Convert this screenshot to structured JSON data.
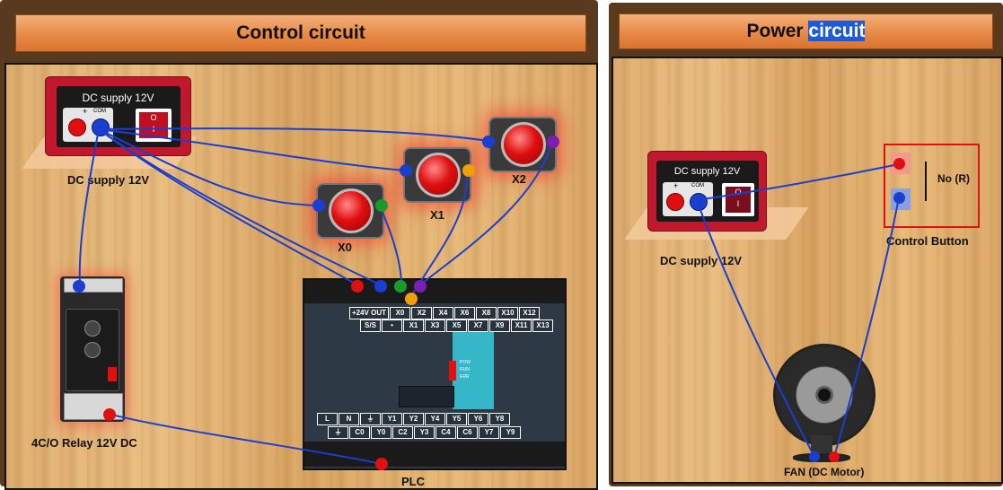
{
  "control": {
    "title": "Control circuit",
    "dc_supply_title": "DC supply 12V",
    "dc_supply_label": "DC supply 12V",
    "jack_plus": "+",
    "jack_com": "COM",
    "switch_o": "O",
    "switch_i": "I",
    "button_x0": "X0",
    "button_x1": "X1",
    "button_x2": "X2",
    "relay_label": "4C/O Relay 12V DC",
    "plc_label": "PLC",
    "plc_top_row1": [
      "+24V OUT",
      "X0",
      "X2",
      "X4",
      "X6",
      "X8",
      "X10",
      "X12"
    ],
    "plc_top_row2": [
      "S/S",
      "•",
      "X1",
      "X3",
      "X5",
      "X7",
      "X9",
      "X11",
      "X13"
    ],
    "plc_bot_row1": [
      "L",
      "N",
      "⏚",
      "Y1",
      "Y2",
      "Y4",
      "Y5",
      "Y6",
      "Y8"
    ],
    "plc_bot_row2": [
      "⏚",
      "C0",
      "Y0",
      "C2",
      "Y3",
      "C4",
      "C6",
      "Y7",
      "Y9"
    ],
    "plc_status": [
      "POW",
      "RUN",
      "ERR"
    ]
  },
  "power": {
    "title_a": "Power",
    "title_b": "circuit",
    "dc_supply_title": "DC supply 12V",
    "dc_supply_label": "DC supply 12V",
    "control_button_label": "Control Button",
    "no_label": "No (R)",
    "fan_label": "FAN (DC Motor)"
  },
  "colors": {
    "wire": "#1a3fd0",
    "red_terminal": "#e01010",
    "blue_terminal": "#1a3fd0",
    "green_terminal": "#1a9a2a",
    "orange_terminal": "#f0a000",
    "purple_terminal": "#7a1fb0",
    "header_orange": "#e88a45"
  }
}
